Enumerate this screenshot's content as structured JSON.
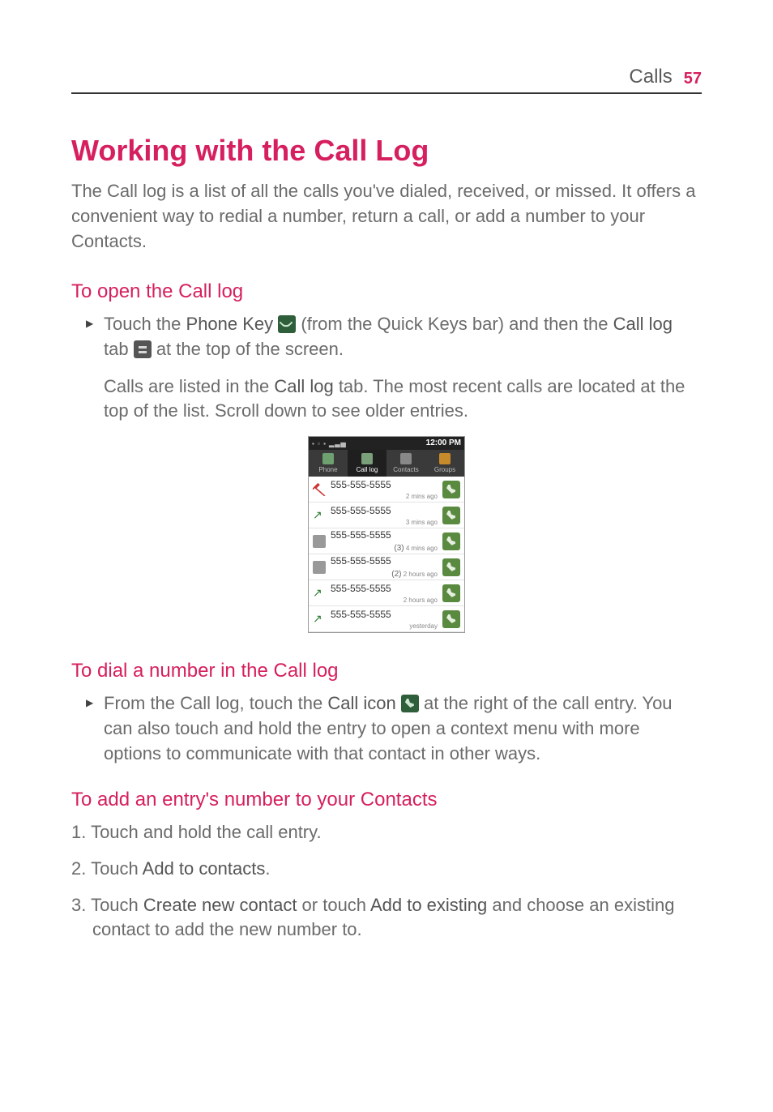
{
  "header": {
    "section": "Calls",
    "page": "57"
  },
  "title": "Working with the Call Log",
  "intro": "The Call log is a list of all the calls you've dialed, received, or missed. It offers a convenient way to redial a number, return a call, or add a number to your Contacts.",
  "s1": {
    "heading": "To open the Call log",
    "bullet_pre": "Touch the ",
    "bullet_k1": "Phone Key",
    "bullet_mid1": " (from the Quick Keys bar) and then the ",
    "bullet_k2": "Call log",
    "bullet_mid2": " tab ",
    "bullet_post": " at the top of the screen.",
    "para2a": "Calls are listed in the ",
    "para2b": "Call log",
    "para2c": " tab. The most recent calls are located at the top of the list. Scroll down to see older entries."
  },
  "shot": {
    "time": "12:00 PM",
    "tabs": [
      "Phone",
      "Call log",
      "Contacts",
      "Groups"
    ],
    "rows": [
      {
        "type": "miss",
        "num": "555-555-5555",
        "time": "2 mins ago",
        "count": ""
      },
      {
        "type": "out",
        "num": "555-555-5555",
        "time": "3 mins ago",
        "count": ""
      },
      {
        "type": "in",
        "num": "555-555-5555",
        "time": "4 mins ago",
        "count": "(3)"
      },
      {
        "type": "in",
        "num": "555-555-5555",
        "time": "2 hours ago",
        "count": "(2)"
      },
      {
        "type": "out",
        "num": "555-555-5555",
        "time": "2 hours ago",
        "count": ""
      },
      {
        "type": "out",
        "num": "555-555-5555",
        "time": "yesterday",
        "count": ""
      }
    ]
  },
  "s2": {
    "heading": "To dial a number in the Call log",
    "b_pre": "From the Call log, touch the ",
    "b_k": "Call icon",
    "b_mid": " at the right of the call entry. You can also touch and hold the entry to open a context menu with more options to communicate with that contact in other ways."
  },
  "s3": {
    "heading": "To add an entry's number to your Contacts",
    "li1": "Touch and hold the call entry.",
    "li2a": "Touch ",
    "li2b": "Add to contacts",
    "li2c": ".",
    "li3a": "Touch ",
    "li3b": "Create new contact",
    "li3c": " or touch ",
    "li3d": "Add to existing",
    "li3e": " and choose an existing contact to add the new number to."
  }
}
